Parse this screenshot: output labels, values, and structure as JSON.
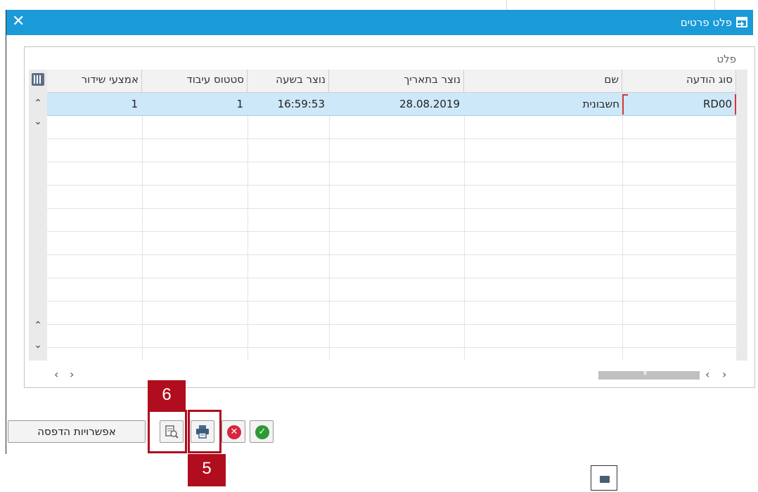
{
  "dialog": {
    "title": "פלט פרטים",
    "close_glyph": "✕",
    "title_icon": "output-details-icon"
  },
  "panel": {
    "label": "פלט"
  },
  "table": {
    "columns": [
      {
        "key": "message_type",
        "label": "סוג הודעה"
      },
      {
        "key": "name",
        "label": "שם"
      },
      {
        "key": "created_date",
        "label": "נוצר בתאריך"
      },
      {
        "key": "created_time",
        "label": "נוצר בשעה"
      },
      {
        "key": "processing_status",
        "label": "סטטוס עיבוד"
      },
      {
        "key": "transmission_medium",
        "label": "אמצעי שידור"
      }
    ],
    "rows": [
      {
        "message_type": "RD00",
        "name": "חשבונית",
        "created_date": "28.08.2019",
        "created_time": "16:59:53",
        "processing_status": "1",
        "transmission_medium": "1"
      }
    ],
    "settings_icon": "table-settings-icon"
  },
  "footer": {
    "print_options_label": "אפשרויות הדפסה",
    "buttons": [
      "print-preview-icon",
      "print-icon",
      "cancel-icon",
      "confirm-icon"
    ]
  },
  "annotations": [
    {
      "label": "6",
      "target": "print-preview-button"
    },
    {
      "label": "5",
      "target": "print-button"
    }
  ],
  "colors": {
    "titlebar": "#1a9bd8",
    "selected_row": "#cde8f8",
    "annotation": "#b00d1e",
    "confirm": "#2d9a33",
    "cancel": "#d7263d"
  }
}
